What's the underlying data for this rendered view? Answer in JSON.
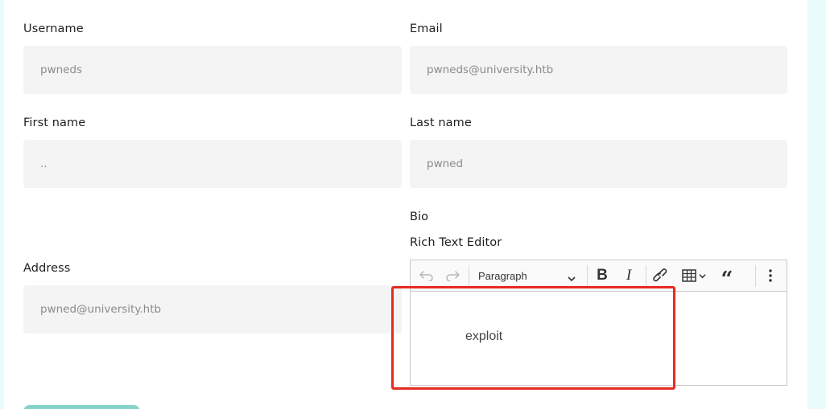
{
  "form": {
    "username": {
      "label": "Username",
      "value": "pwneds"
    },
    "email": {
      "label": "Email",
      "value": "pwneds@university.htb"
    },
    "first_name": {
      "label": "First name",
      "value": ".."
    },
    "last_name": {
      "label": "Last name",
      "value": "pwned"
    },
    "address": {
      "label": "Address",
      "value": "pwned@university.htb"
    },
    "bio": {
      "label": "Bio",
      "editor_label": "Rich Text Editor",
      "paragraph_select": "Paragraph",
      "content": "exploit"
    }
  },
  "colors": {
    "background": "#eafbfb",
    "field_bg": "#f4f4f4",
    "highlight": "#e52b20",
    "button": "#86d3c9"
  },
  "icons": [
    "undo-icon",
    "redo-icon",
    "chevron-down-icon",
    "bold-icon",
    "italic-icon",
    "link-icon",
    "table-icon",
    "quote-icon",
    "more-vertical-icon"
  ]
}
